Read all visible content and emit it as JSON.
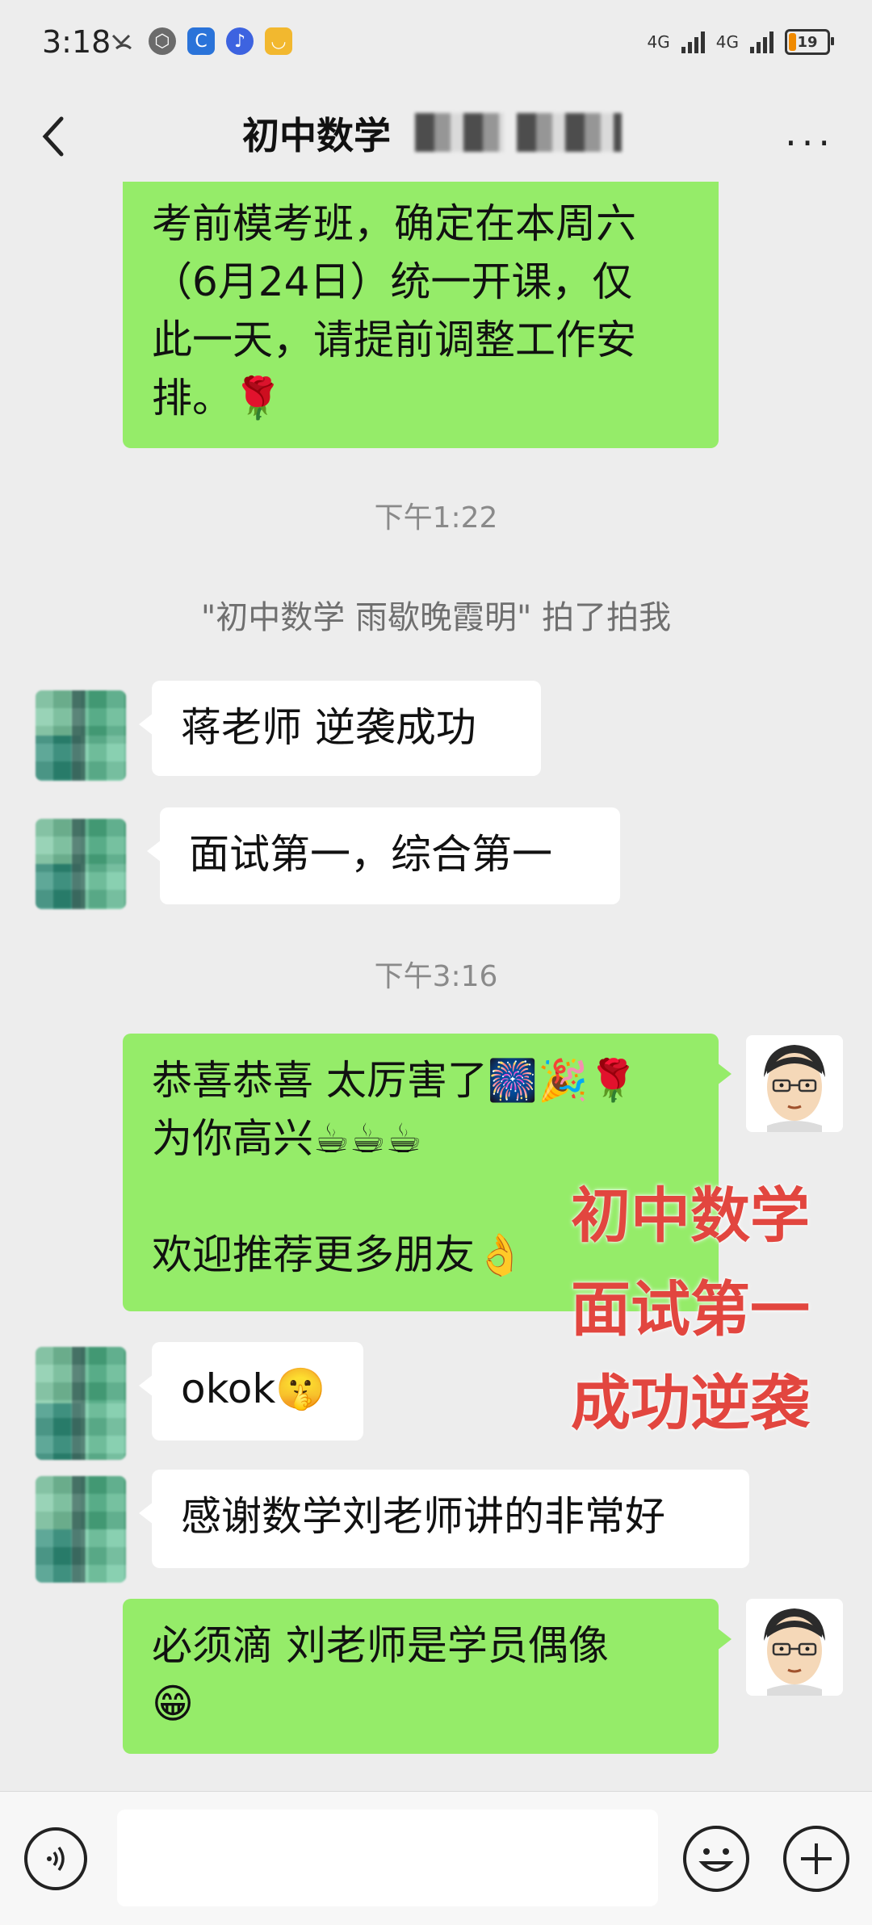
{
  "status_bar": {
    "time": "3:18",
    "network_1": "4G",
    "network_2": "4G",
    "battery_level": "19"
  },
  "header": {
    "title": "初中数学",
    "more_label": "···"
  },
  "messages": {
    "m1_lines": [
      "考前模考班，确定在本周六",
      "（6月24日）统一开课，仅",
      "此一天，请提前调整工作安",
      "排。🌹"
    ],
    "t1": "下午1:22",
    "sys1": "\"初中数学 雨歇晚霞明\" 拍了拍我",
    "m2": "蒋老师 逆袭成功",
    "m3": "面试第一，综合第一",
    "t2": "下午3:16",
    "m4_lines": [
      "恭喜恭喜 太厉害了🎆🎉🌹",
      "为你高兴☕☕☕",
      "",
      "欢迎推荐更多朋友👌"
    ],
    "m5": "okok🤫",
    "m6": "感谢数学刘老师讲的非常好",
    "m7_lines": [
      "必须滴 刘老师是学员偶像",
      "😁"
    ]
  },
  "overlay": {
    "lines": [
      "初中数学",
      "面试第一",
      "成功逆袭"
    ]
  },
  "colors": {
    "bg": "#ededed",
    "self_bubble": "#95ec69",
    "other_bubble": "#ffffff",
    "overlay_text": "#e2463f"
  },
  "input_bar": {
    "placeholder": ""
  },
  "icons": {
    "back": "back-icon",
    "voice": "voice-icon",
    "emoji": "emoji-icon",
    "plus": "plus-icon"
  }
}
